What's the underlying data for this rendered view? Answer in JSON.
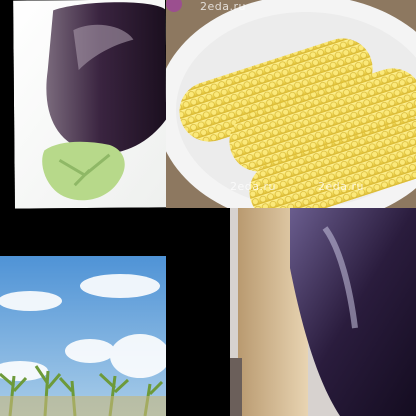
{
  "collage": {
    "tiles": [
      {
        "subject": "eggplant with green calyx on white background"
      },
      {
        "subject": "boiled corn cobs on a white plate"
      },
      {
        "subject": "blue sky with clouds over corn field"
      },
      {
        "subject": "close-up of purple eggplant"
      }
    ],
    "watermarks": {
      "top": "2eda.ru",
      "middle": "2eda.ru",
      "right": "2eda.ru"
    },
    "colors": {
      "corn": "#f4dd5a",
      "eggplant": "#3a2440",
      "sky": "#6aa8dc",
      "leaves": "#b7d98a"
    }
  }
}
